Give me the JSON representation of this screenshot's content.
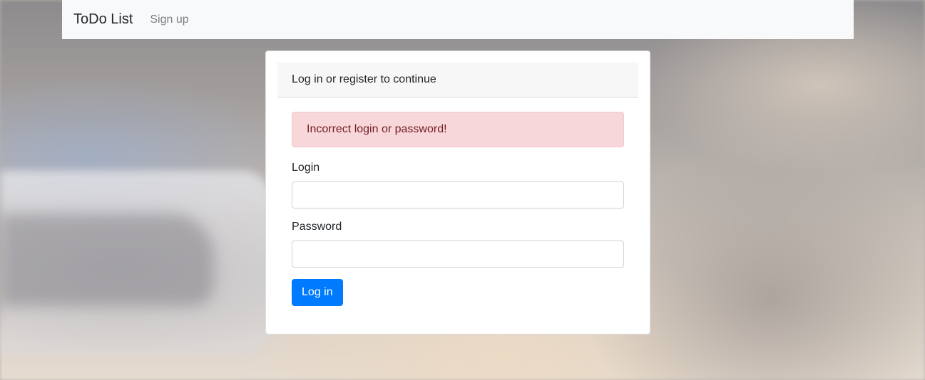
{
  "navbar": {
    "brand": "ToDo List",
    "links": [
      {
        "label": "Sign up"
      }
    ]
  },
  "card": {
    "header": "Log in or register to continue",
    "alert": "Incorrect login or password!",
    "fields": [
      {
        "label": "Login",
        "value": "",
        "placeholder": ""
      },
      {
        "label": "Password",
        "value": "",
        "placeholder": ""
      }
    ],
    "submit_label": "Log in"
  },
  "colors": {
    "primary": "#007bff",
    "navbar_bg": "#f8f9fa",
    "alert_bg": "#f8d7da",
    "alert_text": "#721c24"
  }
}
